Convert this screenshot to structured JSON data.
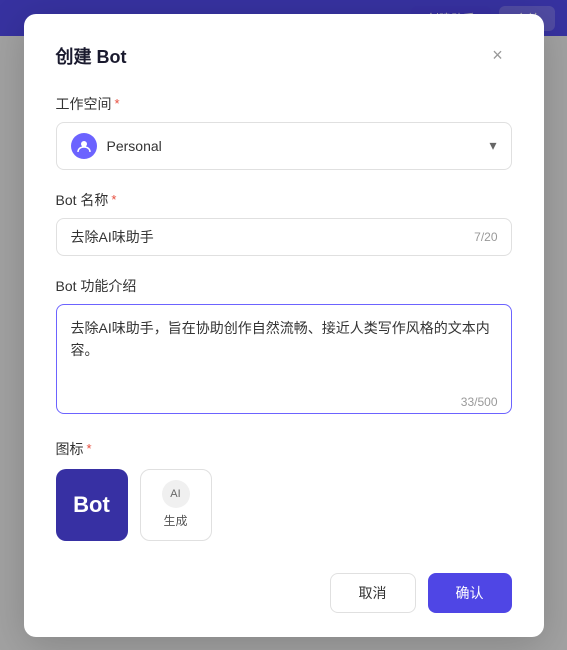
{
  "topbar": {
    "btn1_label": "创建助手",
    "btn2_label": "合并"
  },
  "modal": {
    "title": "创建 Bot",
    "close_label": "×",
    "workspace_label": "工作空间",
    "workspace_required": "*",
    "workspace_name": "Personal",
    "workspace_avatar_icon": "person",
    "bot_name_label": "Bot 名称",
    "bot_name_required": "*",
    "bot_name_value": "去除AI味助手",
    "bot_name_char_count": "7/20",
    "bot_desc_label": "Bot 功能介绍",
    "bot_desc_value": "去除AI味助手，旨在协助创作自然流畅、接近人类写作风格的文本内容。",
    "bot_desc_char_count": "33/500",
    "icon_label": "图标",
    "icon_required": "*",
    "icon_selected_text": "Bot",
    "icon_generate_ai_label": "AI",
    "icon_generate_label": "生成",
    "cancel_label": "取消",
    "confirm_label": "确认"
  }
}
